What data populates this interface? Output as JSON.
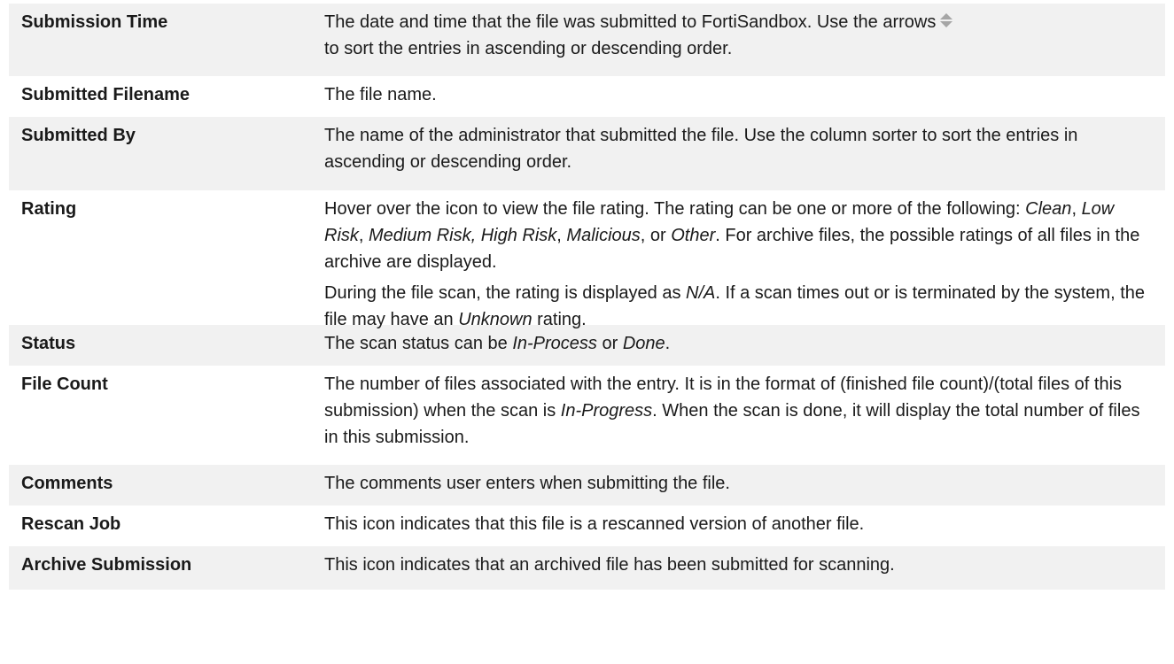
{
  "rows": [
    {
      "term": "Submission Time",
      "desc_parts": {
        "a": "The date and time that the file was submitted to FortiSandbox. Use the arrows",
        "b": "to sort the entries in ascending or descending order."
      }
    },
    {
      "term": "Submitted Filename",
      "desc": "The file name."
    },
    {
      "term": "Submitted By",
      "desc": "The name of the administrator that submitted the file. Use the column sorter to sort the entries in ascending or descending order."
    },
    {
      "term": "Rating",
      "p1": {
        "t1": "Hover over the icon to view the file rating. The rating can be one or more of the following: ",
        "i1": "Clean",
        "t2": ", ",
        "i2": "Low Risk",
        "t3": ", ",
        "i3": "Medium Risk, High Risk",
        "t4": ", ",
        "i4": "Malicious",
        "t5": ", or ",
        "i5": "Other",
        "t6": ". For archive files, the possible ratings of all files in the archive are displayed."
      },
      "p2": {
        "t1": "During the file scan, the rating is displayed as ",
        "i1": "N/A",
        "t2": ". If a scan times out or is terminated by the system, the file may have an ",
        "i2": "Unknown",
        "t3": " rating."
      }
    },
    {
      "term": "Status",
      "parts": {
        "t1": "The scan status can be ",
        "i1": "In-Process",
        "t2": " or ",
        "i2": "Done",
        "t3": "."
      }
    },
    {
      "term": "File Count",
      "parts": {
        "t1": "The number of files associated with the entry. It is in the format of (finished file count)/(total files of this submission) when the scan is ",
        "i1": "In-Progress",
        "t2": ". When the scan is done, it will display the total number of files in this submission."
      }
    },
    {
      "term": "Comments",
      "desc": "The comments user enters when submitting the file."
    },
    {
      "term": "Rescan Job",
      "desc": "This icon indicates that this file is a rescanned version of another file."
    },
    {
      "term": "Archive Submission",
      "desc": "This icon indicates that an archived file has been submitted for scanning."
    }
  ],
  "icons": {
    "sort": "sort-arrows-icon"
  },
  "colors": {
    "alt_row": "#f1f1f1",
    "text": "#1a1a1a",
    "icon": "#a6a6a6"
  }
}
